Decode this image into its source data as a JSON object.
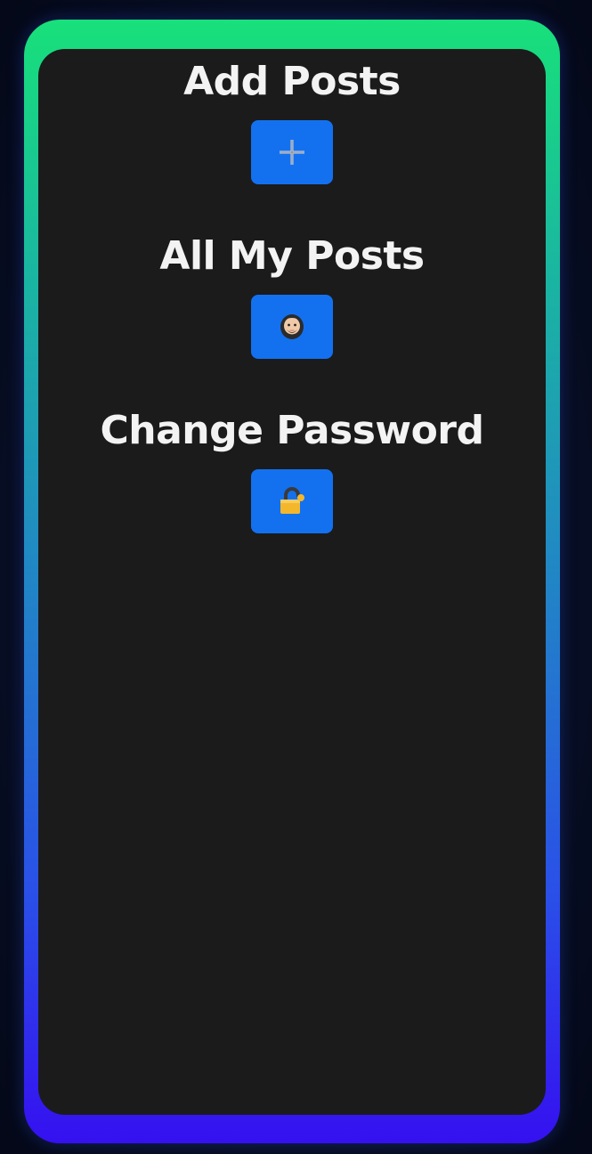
{
  "sections": [
    {
      "title": "Add Posts",
      "icon": "plus-icon",
      "button": "add-posts-button"
    },
    {
      "title": "All My Posts",
      "icon": "person-icon",
      "button": "all-my-posts-button"
    },
    {
      "title": "Change Password",
      "icon": "lock-icon",
      "button": "change-password-button"
    }
  ],
  "colors": {
    "button": "#1371f0",
    "panel": "#1b1b1b",
    "frame_top": "#18e07a",
    "frame_bottom": "#3510f0",
    "text": "#f3f3f3"
  }
}
